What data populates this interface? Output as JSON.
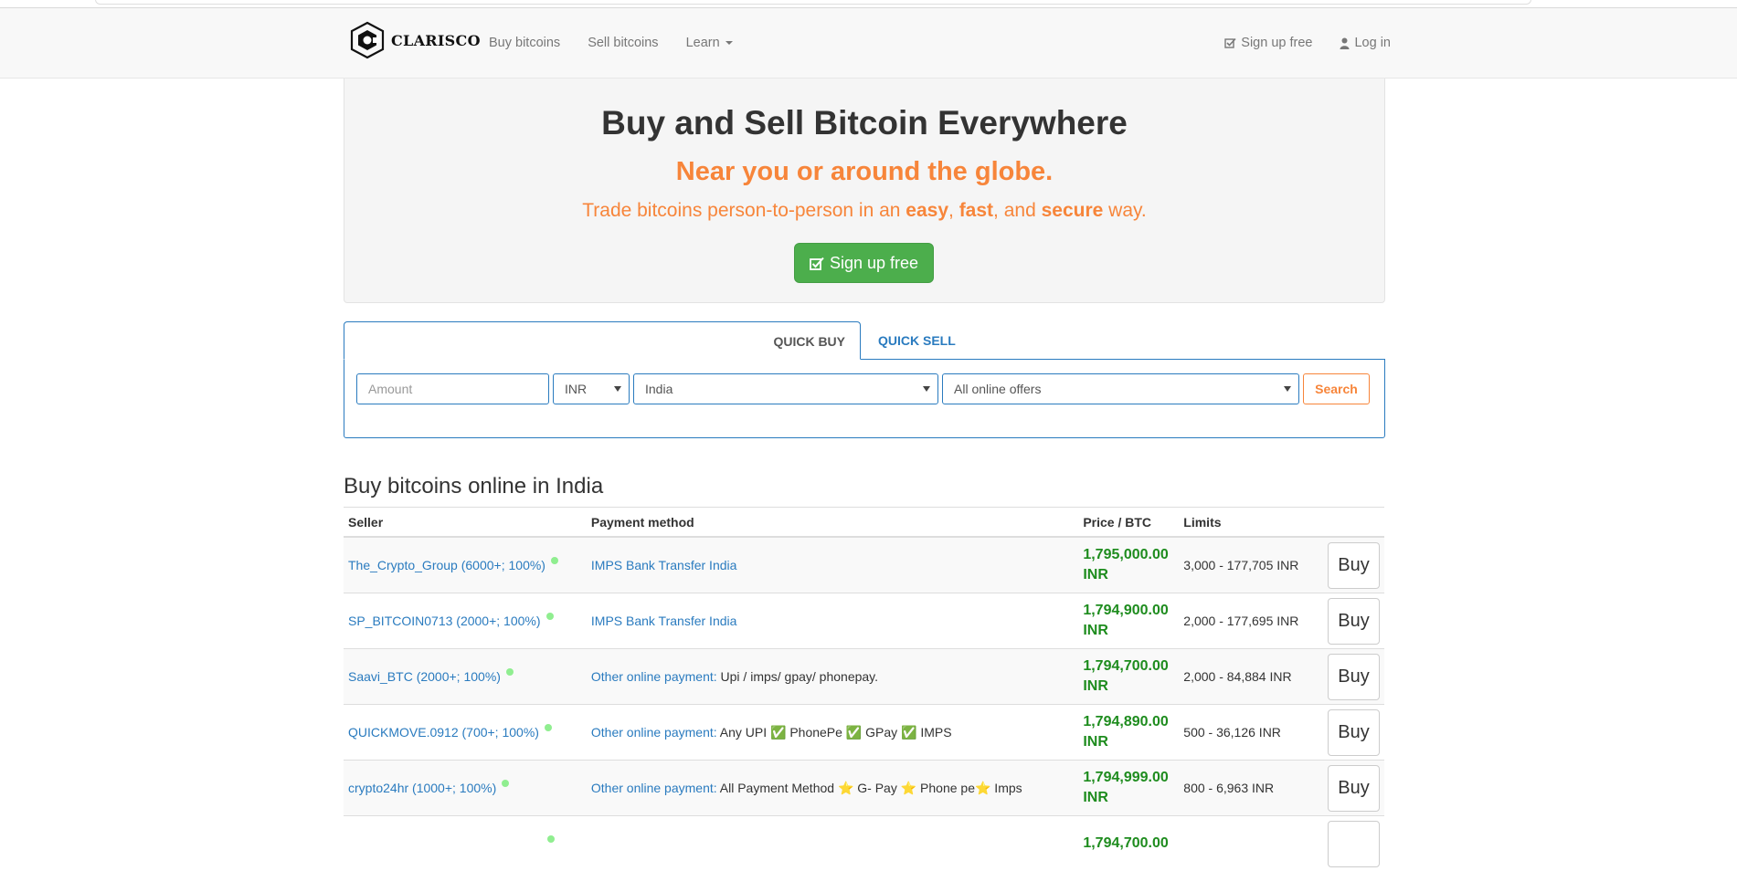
{
  "brand": {
    "name": "CLARISCO"
  },
  "nav": {
    "buy": "Buy bitcoins",
    "sell": "Sell bitcoins",
    "learn": "Learn",
    "signup": "Sign up free",
    "login": "Log in"
  },
  "hero": {
    "title": "Buy and Sell Bitcoin Everywhere",
    "subtitle": "Near you or around the globe.",
    "lead_prefix": "Trade bitcoins person-to-person in an ",
    "lead_easy": "easy",
    "lead_sep1": ", ",
    "lead_fast": "fast",
    "lead_sep2": ", and ",
    "lead_secure": "secure",
    "lead_suffix": " way.",
    "cta": "Sign up free"
  },
  "quick": {
    "tab_buy": "QUICK BUY",
    "tab_sell": "QUICK SELL",
    "amount_placeholder": "Amount",
    "currency": "INR",
    "country": "India",
    "offer_type": "All online offers",
    "search": "Search"
  },
  "offers": {
    "title": "Buy bitcoins online in India",
    "headers": {
      "seller": "Seller",
      "payment": "Payment method",
      "price": "Price / BTC",
      "limits": "Limits"
    },
    "buy_label": "Buy",
    "rows": [
      {
        "seller": "The_Crypto_Group (6000+; 100%)",
        "method": "IMPS Bank Transfer India",
        "desc": "",
        "price": "1,795,000.00",
        "currency": "INR",
        "limits": "3,000 - 177,705 INR"
      },
      {
        "seller": "SP_BITCOIN0713 (2000+; 100%)",
        "method": "IMPS Bank Transfer India",
        "desc": "",
        "price": "1,794,900.00",
        "currency": "INR",
        "limits": "2,000 - 177,695 INR"
      },
      {
        "seller": "Saavi_BTC (2000+; 100%)",
        "method": "Other online payment:",
        "desc": "Upi / imps/ gpay/ phonepay.",
        "price": "1,794,700.00",
        "currency": "INR",
        "limits": "2,000 - 84,884 INR"
      },
      {
        "seller": "QUICKMOVE.0912 (700+; 100%)",
        "method": "Other online payment:",
        "desc": "Any UPI ✅ PhonePe ✅ GPay ✅ IMPS",
        "price": "1,794,890.00",
        "currency": "INR",
        "limits": "500 - 36,126 INR"
      },
      {
        "seller": "crypto24hr (1000+; 100%)",
        "method": "Other online payment:",
        "desc": "All Payment Method ⭐ G- Pay ⭐ Phone pe⭐ Imps",
        "price": "1,794,999.00",
        "currency": "INR",
        "limits": "800 - 6,963 INR"
      },
      {
        "seller": "",
        "method": "",
        "desc": "",
        "price": "1,794,700.00",
        "currency": "",
        "limits": ""
      }
    ]
  }
}
